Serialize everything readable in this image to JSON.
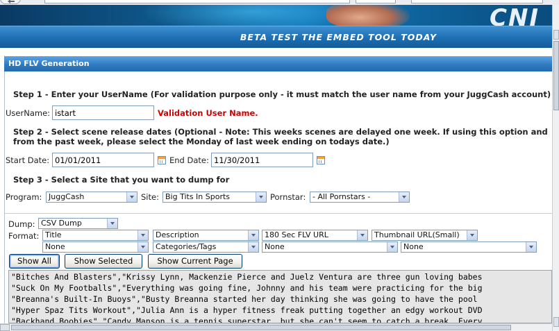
{
  "banner": {
    "logo_text": "CNI",
    "subheading": "BETA TEST THE EMBED TOOL TODAY"
  },
  "panel": {
    "title": "HD FLV Generation"
  },
  "step1": {
    "heading": "Step 1 - Enter your UserName (For validation purpose only - it must match the user name from your JuggCash account)",
    "username_label": "UserName:",
    "username_value": "istart",
    "validation_message": "Validation User Name."
  },
  "step2": {
    "heading_line1": "Step 2 - Select scene release dates (Optional - Note: This weeks scenes are delayed one week. If using this option and",
    "heading_line2": "from the past week, please select the Monday of last week ending on todays date.)",
    "start_label": "Start Date:",
    "start_value": "01/01/2011",
    "end_label": "End Date:",
    "end_value": "11/30/2011"
  },
  "step3": {
    "heading": "Step 3 - Select a Site that you want to dump for",
    "program_label": "Program:",
    "program_value": "JuggCash",
    "site_label": "Site:",
    "site_value": "Big Tits In Sports",
    "pornstar_label": "Pornstar:",
    "pornstar_value": "- All Pornstars -"
  },
  "dump": {
    "dump_label": "Dump:",
    "dump_value": "CSV Dump",
    "format_label": "Format:",
    "format_row1": [
      "Title",
      "Description",
      "180 Sec FLV URL",
      "Thumbnail URL(Small)"
    ],
    "format_row2": [
      "None",
      "Categories/Tags",
      "None",
      "None"
    ]
  },
  "buttons": {
    "show_all": "Show All",
    "show_selected": "Show Selected",
    "show_current_page": "Show Current Page"
  },
  "output_lines": [
    "\"Bitches And Blasters\",\"Krissy Lynn, Mackenzie Pierce and Juelz Ventura are three gun loving babes",
    "\"Suck On My Footballs\",\"Everything was going fine, Johnny and his team were practicing for the big",
    "\"Breanna's Built-In Buoys\",\"Busty Breanna started her day thinking she was going to have the pool",
    "\"Hyper Spaz Tits Workout\",\"Julia Ann is a hyper fitness freak putting together an edgy workout DVD",
    "\"Backhand Boobies\",\"Candy Manson is a tennis superstar, but she can't seem to catch a break. Every"
  ]
}
